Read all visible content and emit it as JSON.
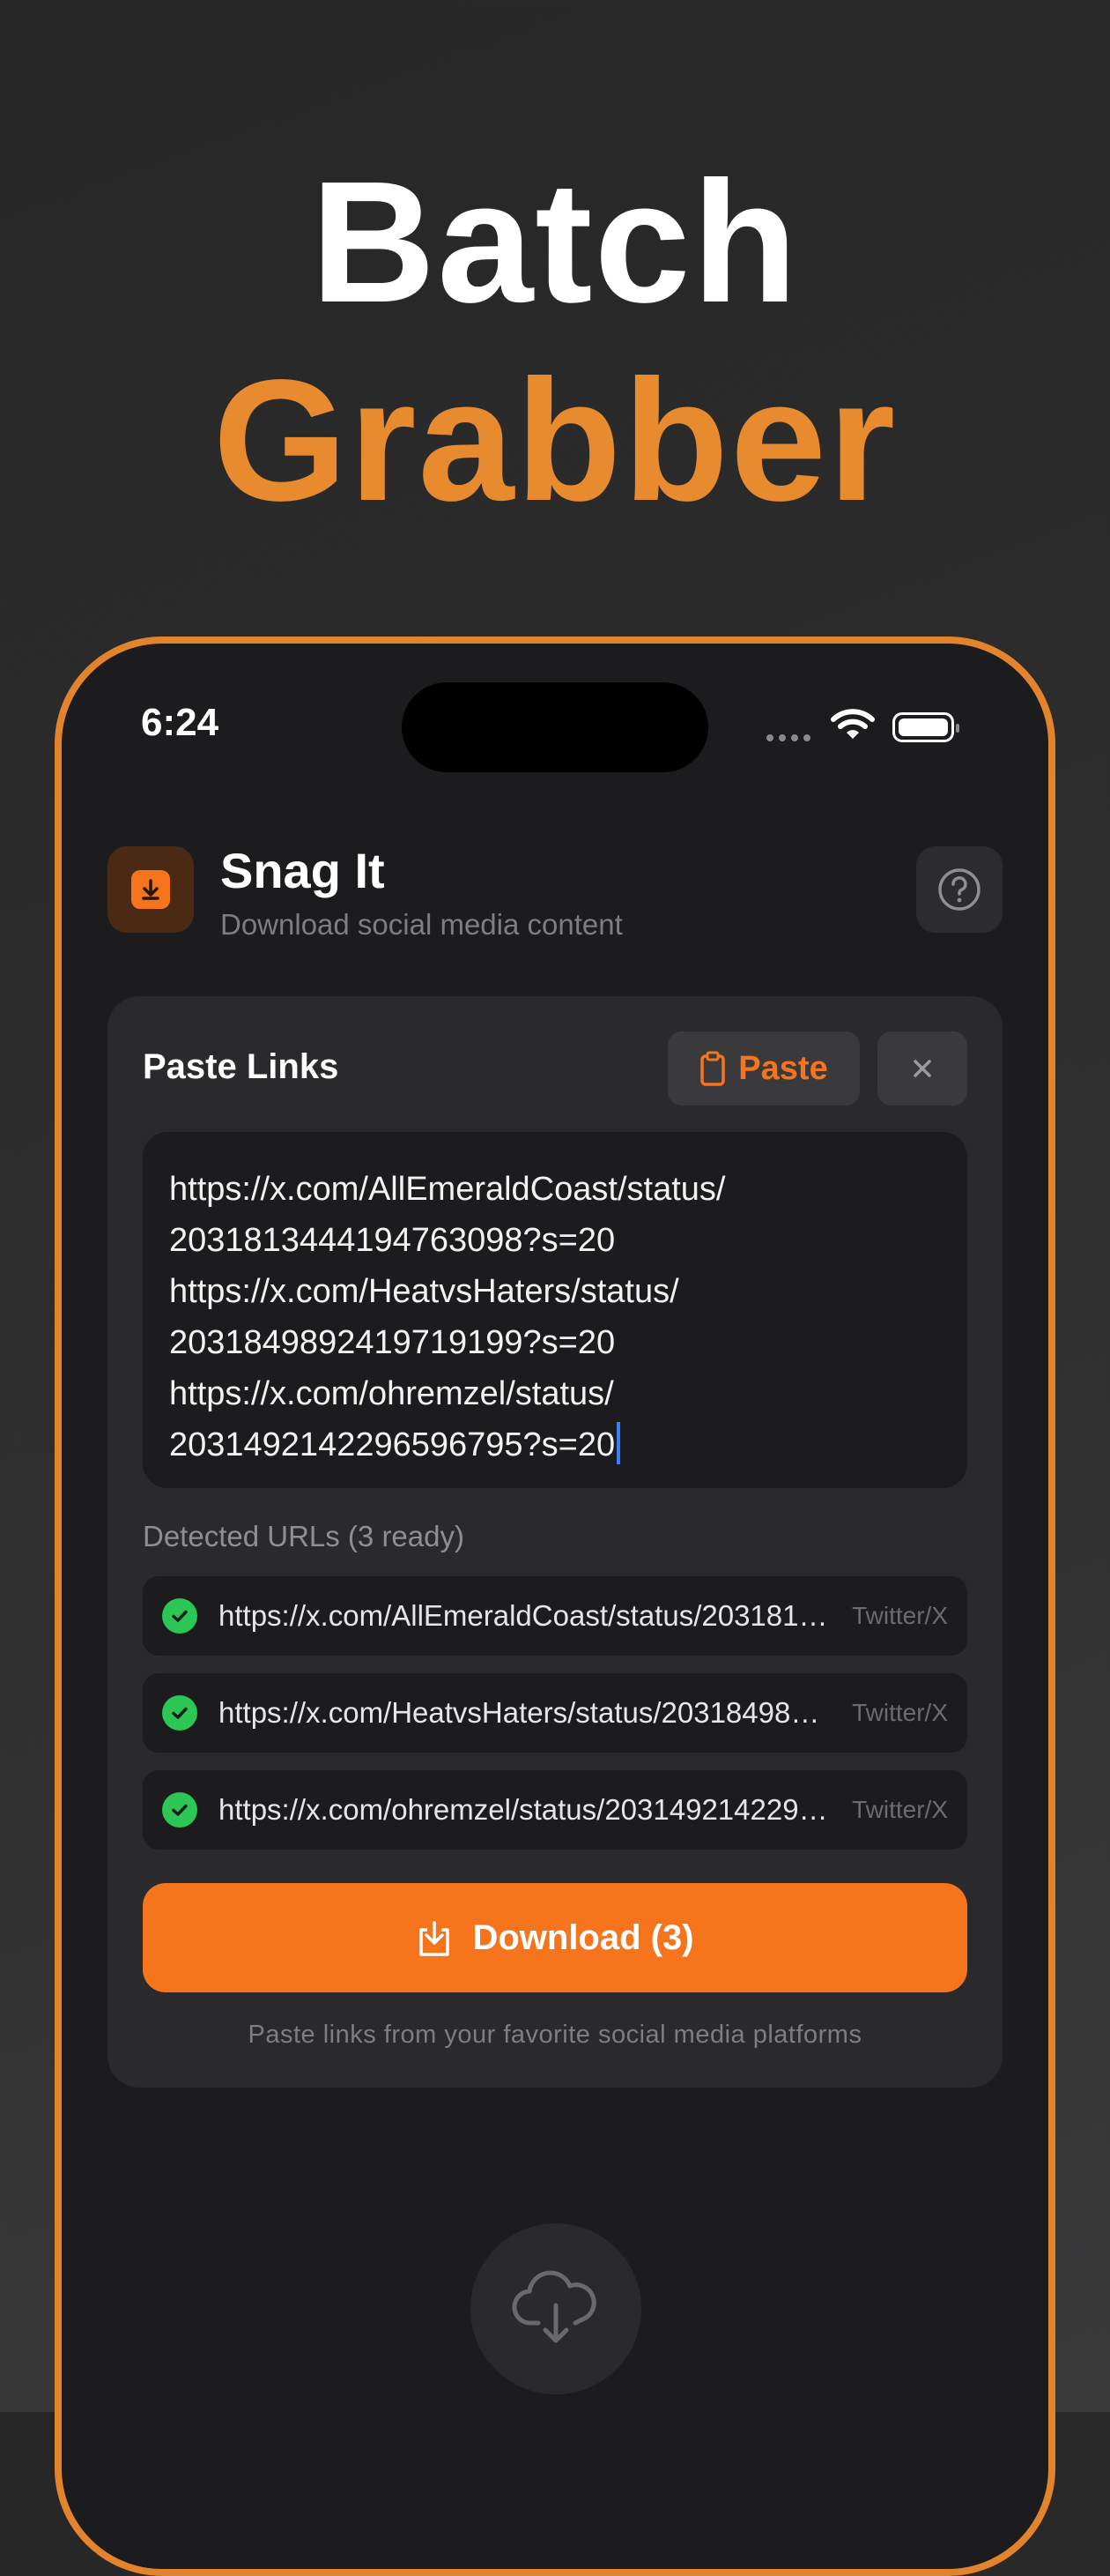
{
  "hero": {
    "line1": "Batch",
    "line2": "Grabber"
  },
  "status_bar": {
    "time": "6:24"
  },
  "app": {
    "title": "Snag It",
    "subtitle": "Download social media content"
  },
  "card": {
    "title": "Paste Links",
    "paste_label": "Paste",
    "textarea_lines": [
      "https://x.com/AllEmeraldCoast/status/",
      "2031813444194763098?s=20",
      "https://x.com/HeatvsHaters/status/",
      "2031849892419719199?s=20",
      "https://x.com/ohremzel/status/",
      "2031492142296596795?s=20"
    ],
    "detected_label": "Detected URLs (3 ready)",
    "urls": [
      {
        "url": "https://x.com/AllEmeraldCoast/status/2031813444194763098?s=20",
        "platform": "Twitter/X"
      },
      {
        "url": "https://x.com/HeatvsHaters/status/2031849892419719199?s=20",
        "platform": "Twitter/X"
      },
      {
        "url": "https://x.com/ohremzel/status/2031492142296596795?s=20",
        "platform": "Twitter/X"
      }
    ],
    "download_label": "Download (3)",
    "footnote": "Paste links from your favorite social media platforms"
  },
  "colors": {
    "accent": "#f5741c",
    "hero_orange": "#e88b2f",
    "success": "#2bc653"
  }
}
